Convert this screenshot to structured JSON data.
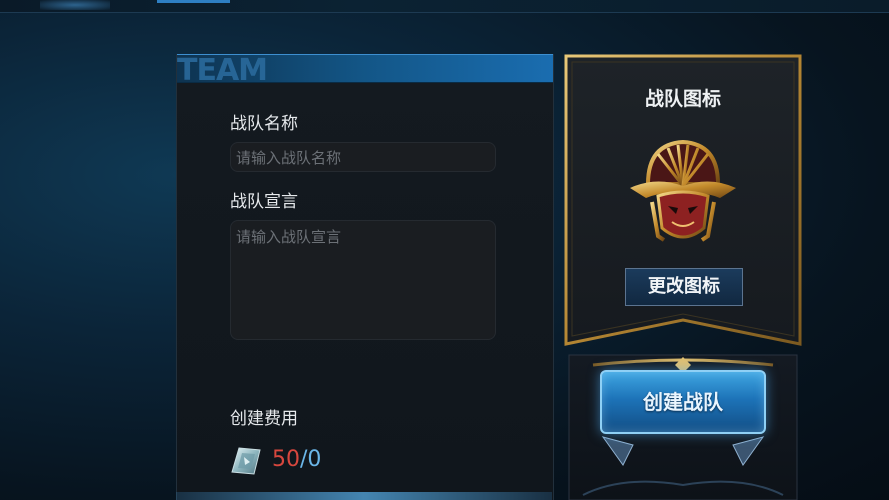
{
  "panel": {
    "header_text": "TEAM",
    "name_label": "战队名称",
    "name_placeholder": "请输入战队名称",
    "declaration_label": "战队宣言",
    "declaration_placeholder": "请输入战队宣言",
    "cost_label": "创建费用",
    "cost_have": "50",
    "cost_sep": "/",
    "cost_need": "0"
  },
  "icon_panel": {
    "title": "战队图标",
    "change_button": "更改图标"
  },
  "create_button": "创建战队",
  "colors": {
    "accent_blue": "#1d73b8",
    "gold": "#c9a04a",
    "cost_red": "#d8473e",
    "cost_blue": "#6bb6e8"
  },
  "icons": {
    "currency": "crystal-gem-icon",
    "emblem": "golden-mask-emblem-icon"
  }
}
